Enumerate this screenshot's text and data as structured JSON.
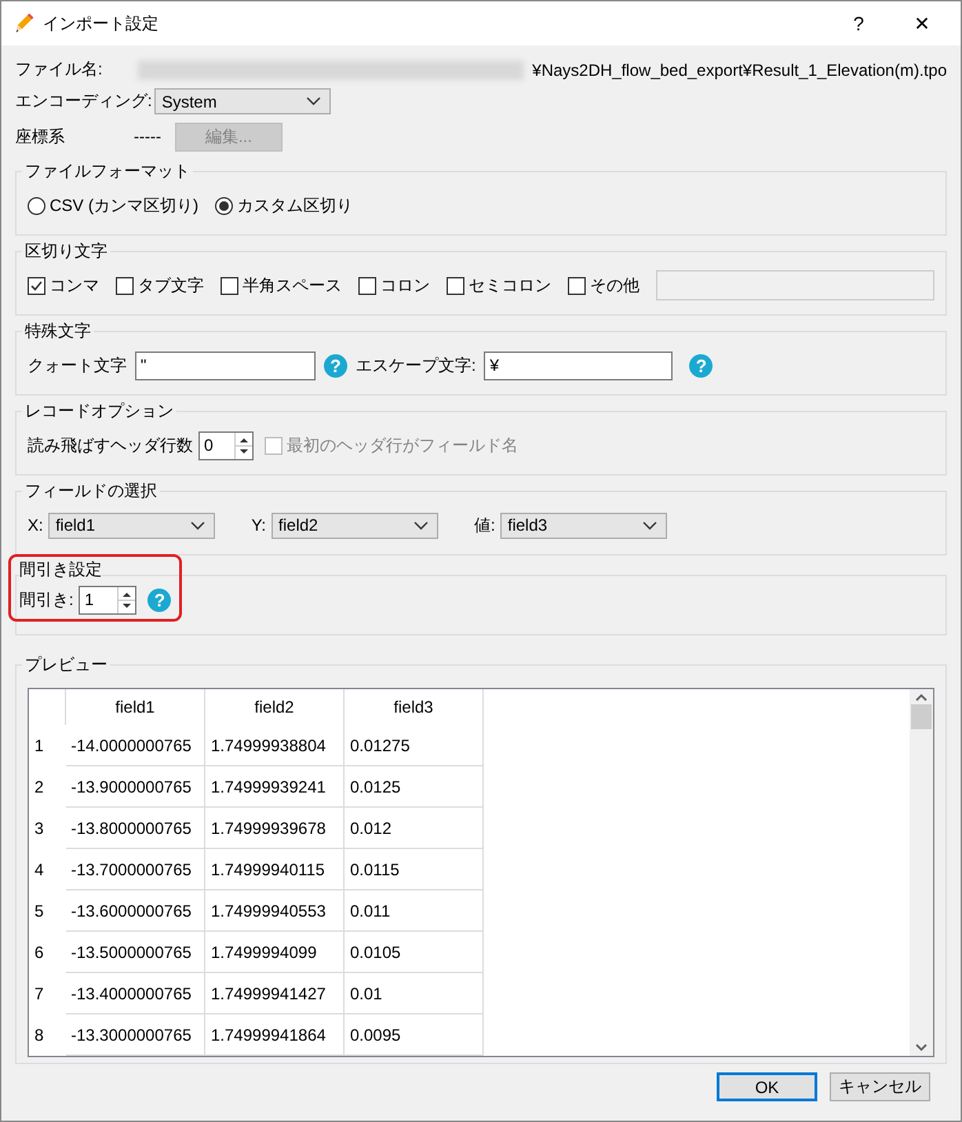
{
  "window": {
    "title": "インポート設定",
    "help": "?",
    "close": "✕"
  },
  "file": {
    "label": "ファイル名:",
    "value": "¥Nays2DH_flow_bed_export¥Result_1_Elevation(m).tpo"
  },
  "encoding": {
    "label": "エンコーディング:",
    "value": "System"
  },
  "coords": {
    "label": "座標系",
    "value": "-----",
    "button": {
      "label": "編集...",
      "disabled": true
    }
  },
  "file_format": {
    "title": "ファイルフォーマット",
    "options": [
      {
        "label": "CSV (カンマ区切り)",
        "selected": false
      },
      {
        "label": "カスタム区切り",
        "selected": true
      }
    ]
  },
  "delimiters": {
    "title": "区切り文字",
    "options": [
      {
        "label": "コンマ",
        "checked": true
      },
      {
        "label": "タブ文字",
        "checked": false
      },
      {
        "label": "半角スペース",
        "checked": false
      },
      {
        "label": "コロン",
        "checked": false
      },
      {
        "label": "セミコロン",
        "checked": false
      },
      {
        "label": "その他",
        "checked": false
      }
    ],
    "other_disabled": true
  },
  "special": {
    "title": "特殊文字",
    "quote": {
      "label": "クォート文字",
      "value": "\"",
      "help": "?"
    },
    "escape": {
      "label": "エスケープ文字:",
      "value": "¥",
      "help": "?"
    }
  },
  "record": {
    "title": "レコードオプション",
    "skip_label": "読み飛ばすヘッダ行数",
    "skip_value": "0",
    "header_checkbox": {
      "label": "最初のヘッダ行がフィールド名",
      "checked": false,
      "disabled": true
    }
  },
  "fields": {
    "title": "フィールドの選択",
    "selectors": [
      {
        "label": "X:",
        "value": "field1"
      },
      {
        "label": "Y:",
        "value": "field2"
      },
      {
        "label": "値:",
        "value": "field3"
      }
    ]
  },
  "thinning": {
    "title": "間引き設定",
    "label": "間引き:",
    "value": "1",
    "help": "?",
    "highlighted": true
  },
  "preview": {
    "title": "プレビュー",
    "columns": [
      "field1",
      "field2",
      "field3"
    ],
    "rows": [
      {
        "index": "1",
        "cells": [
          "-14.0000000765",
          "1.74999938804",
          "0.01275"
        ]
      },
      {
        "index": "2",
        "cells": [
          "-13.9000000765",
          "1.74999939241",
          "0.0125"
        ]
      },
      {
        "index": "3",
        "cells": [
          "-13.8000000765",
          "1.74999939678",
          "0.012"
        ]
      },
      {
        "index": "4",
        "cells": [
          "-13.7000000765",
          "1.74999940115",
          "0.0115"
        ]
      },
      {
        "index": "5",
        "cells": [
          "-13.6000000765",
          "1.74999940553",
          "0.011"
        ]
      },
      {
        "index": "6",
        "cells": [
          "-13.5000000765",
          "1.7499994099",
          "0.0105"
        ]
      },
      {
        "index": "7",
        "cells": [
          "-13.4000000765",
          "1.74999941427",
          "0.01"
        ]
      },
      {
        "index": "8",
        "cells": [
          "-13.3000000765",
          "1.74999941864",
          "0.0095"
        ]
      }
    ]
  },
  "buttons": [
    {
      "label": "OK",
      "default": true
    },
    {
      "label": "キャンセル",
      "default": false
    }
  ]
}
